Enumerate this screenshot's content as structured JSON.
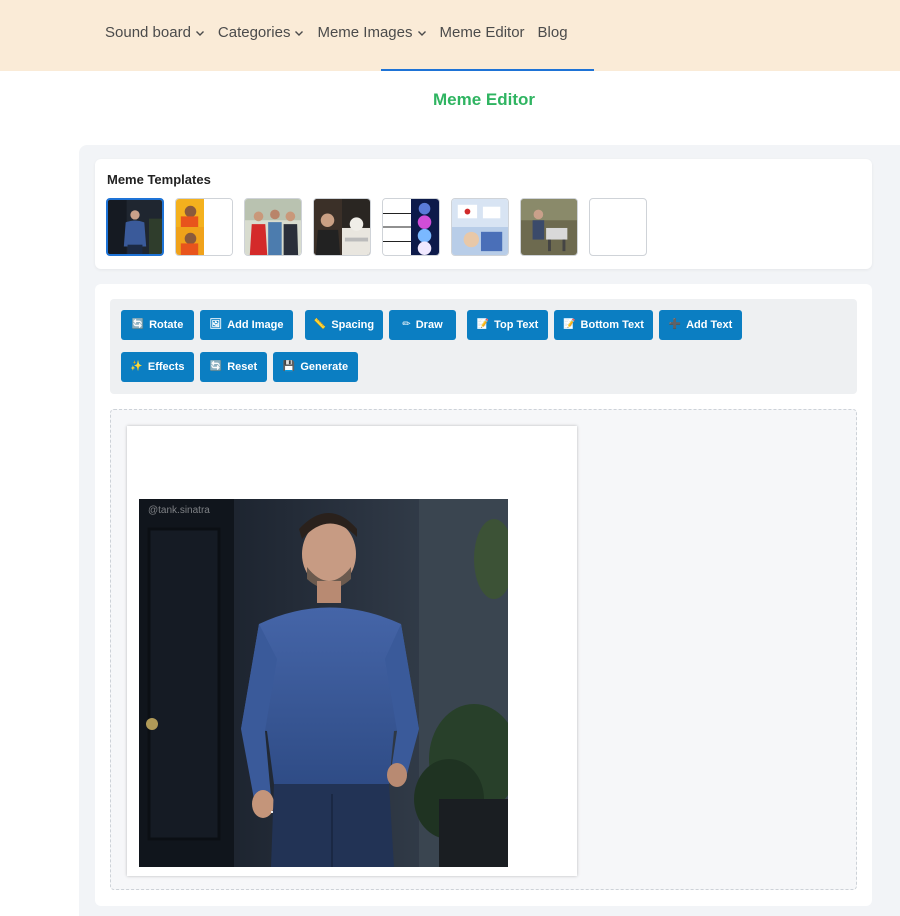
{
  "nav": {
    "items": [
      {
        "label": "Sound board",
        "has_dropdown": true
      },
      {
        "label": "Categories",
        "has_dropdown": true
      },
      {
        "label": "Meme Images",
        "has_dropdown": true
      },
      {
        "label": "Meme Editor",
        "has_dropdown": false
      },
      {
        "label": "Blog",
        "has_dropdown": false
      }
    ]
  },
  "page": {
    "title": "Meme Editor"
  },
  "templates": {
    "title": "Meme Templates",
    "items": [
      {
        "name": "sad-affleck",
        "selected": true
      },
      {
        "name": "drake-hotline-bling",
        "selected": false
      },
      {
        "name": "distracted-boyfriend",
        "selected": false
      },
      {
        "name": "woman-yelling-at-cat",
        "selected": false
      },
      {
        "name": "expanding-brain",
        "selected": false
      },
      {
        "name": "is-this-a-pigeon",
        "selected": false
      },
      {
        "name": "change-my-mind",
        "selected": false
      },
      {
        "name": "blank",
        "selected": false
      }
    ]
  },
  "toolbar": {
    "buttons": [
      {
        "label": "Rotate",
        "icon": "🔄"
      },
      {
        "label": "Add Image",
        "icon": "🖼"
      },
      {
        "label": "Spacing",
        "icon": "📏"
      },
      {
        "label": "Draw",
        "icon": "✏"
      },
      {
        "label": "Top Text",
        "icon": "📝"
      },
      {
        "label": "Bottom Text",
        "icon": "📝"
      },
      {
        "label": "Add Text",
        "icon": "➕"
      },
      {
        "label": "Effects",
        "icon": "✨"
      },
      {
        "label": "Reset",
        "icon": "🔄"
      },
      {
        "label": "Generate",
        "icon": "💾"
      }
    ]
  },
  "canvas": {
    "watermark": "@tank.sinatra"
  },
  "colors": {
    "nav_bg": "#faebd7",
    "accent": "#1e73d6",
    "title": "#2fb461",
    "button": "#0b7ec2"
  }
}
